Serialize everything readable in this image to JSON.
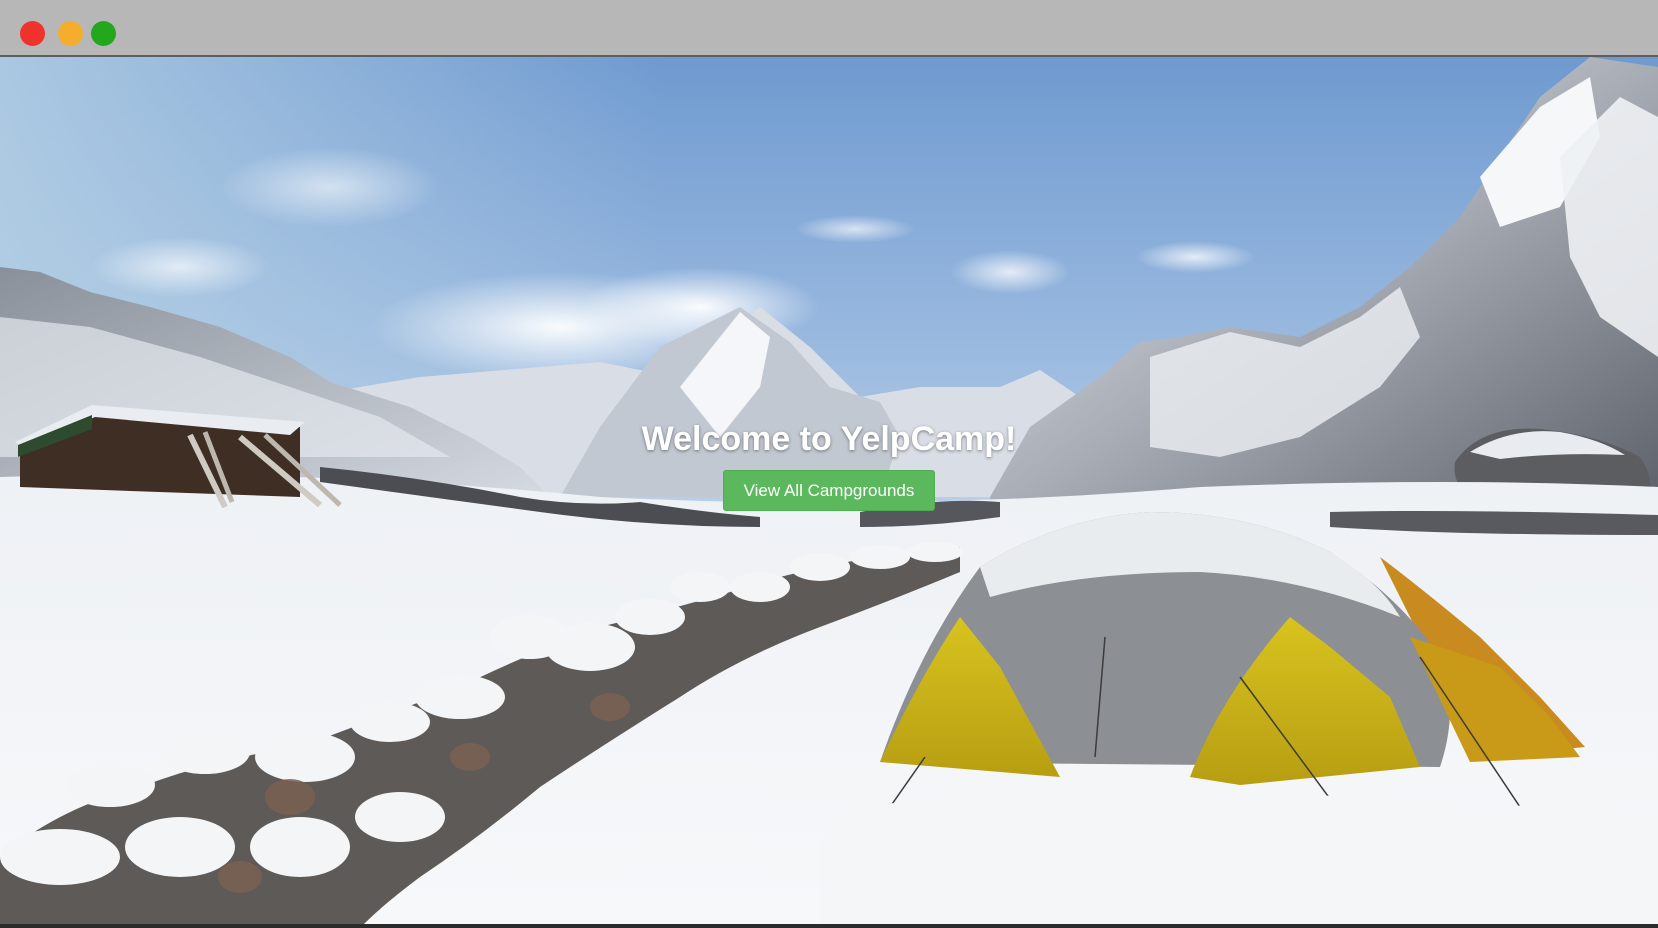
{
  "window": {
    "controls": [
      "close",
      "minimize",
      "maximize"
    ],
    "colors": {
      "close": "#f0322c",
      "minimize": "#f5ad2e",
      "maximize": "#23a81d",
      "titlebar": "#b7b7b7"
    }
  },
  "hero": {
    "title": "Welcome to YelpCamp!",
    "button_label": "View All Campgrounds",
    "button_color": "#5cb85c",
    "background_image": "snowy-mountain-campsite-with-yellow-tent"
  }
}
